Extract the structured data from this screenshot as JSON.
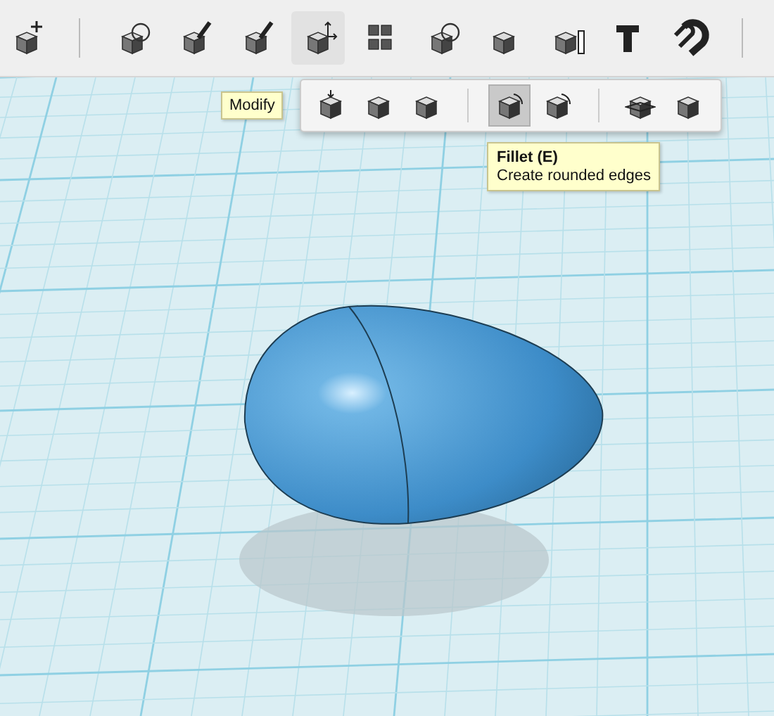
{
  "toolbar": {
    "tools": [
      {
        "selected": false
      },
      {
        "selected": false
      },
      {
        "selected": false
      },
      {
        "selected": false
      },
      {
        "selected": true
      },
      {
        "selected": false
      },
      {
        "selected": false
      },
      {
        "selected": false
      },
      {
        "selected": false
      },
      {
        "selected": false
      },
      {
        "selected": false
      }
    ],
    "tooltip": "Modify"
  },
  "flyout": {
    "items": [
      {
        "selected": false
      },
      {
        "selected": false
      },
      {
        "selected": false
      },
      {
        "selected": true
      },
      {
        "selected": false
      },
      {
        "selected": false
      },
      {
        "selected": false
      }
    ],
    "tooltip": {
      "title": "Fillet (E)",
      "description": "Create rounded edges"
    }
  }
}
